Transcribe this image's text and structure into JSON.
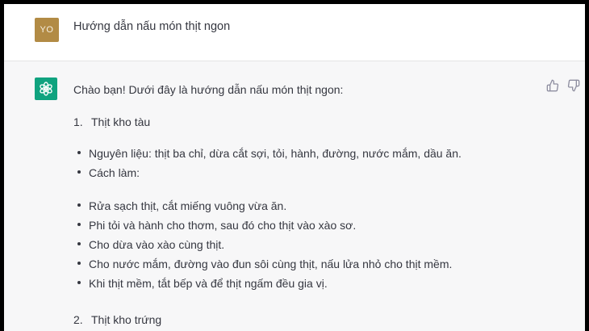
{
  "user": {
    "avatar_initials": "YO",
    "avatar_color": "#b28b45",
    "message": "Hướng dẫn nấu món thịt ngon"
  },
  "assistant": {
    "avatar_icon": "openai-logo-icon",
    "avatar_color": "#10a37f",
    "intro": "Chào bạn! Dưới đây là hướng dẫn nấu món thịt ngon:",
    "items": [
      {
        "number": "1.",
        "title": "Thịt kho tàu",
        "details": [
          "Nguyên liệu: thịt ba chỉ, dừa cắt sợi, tỏi, hành, đường, nước mắm, dầu ăn.",
          "Cách làm:"
        ],
        "steps": [
          "Rửa sạch thịt, cắt miếng vuông vừa ăn.",
          "Phi tỏi và hành cho thơm, sau đó cho thịt vào xào sơ.",
          "Cho dừa vào xào cùng thịt.",
          "Cho nước mắm, đường vào đun sôi cùng thịt, nấu lửa nhỏ cho thịt mềm.",
          "Khi thịt mềm, tắt bếp và để thịt ngấm đều gia vị."
        ]
      },
      {
        "number": "2.",
        "title": "Thịt kho trứng"
      }
    ]
  },
  "actions": {
    "thumbs_up_icon": "thumbs-up-icon",
    "thumbs_down_icon": "thumbs-down-icon"
  }
}
